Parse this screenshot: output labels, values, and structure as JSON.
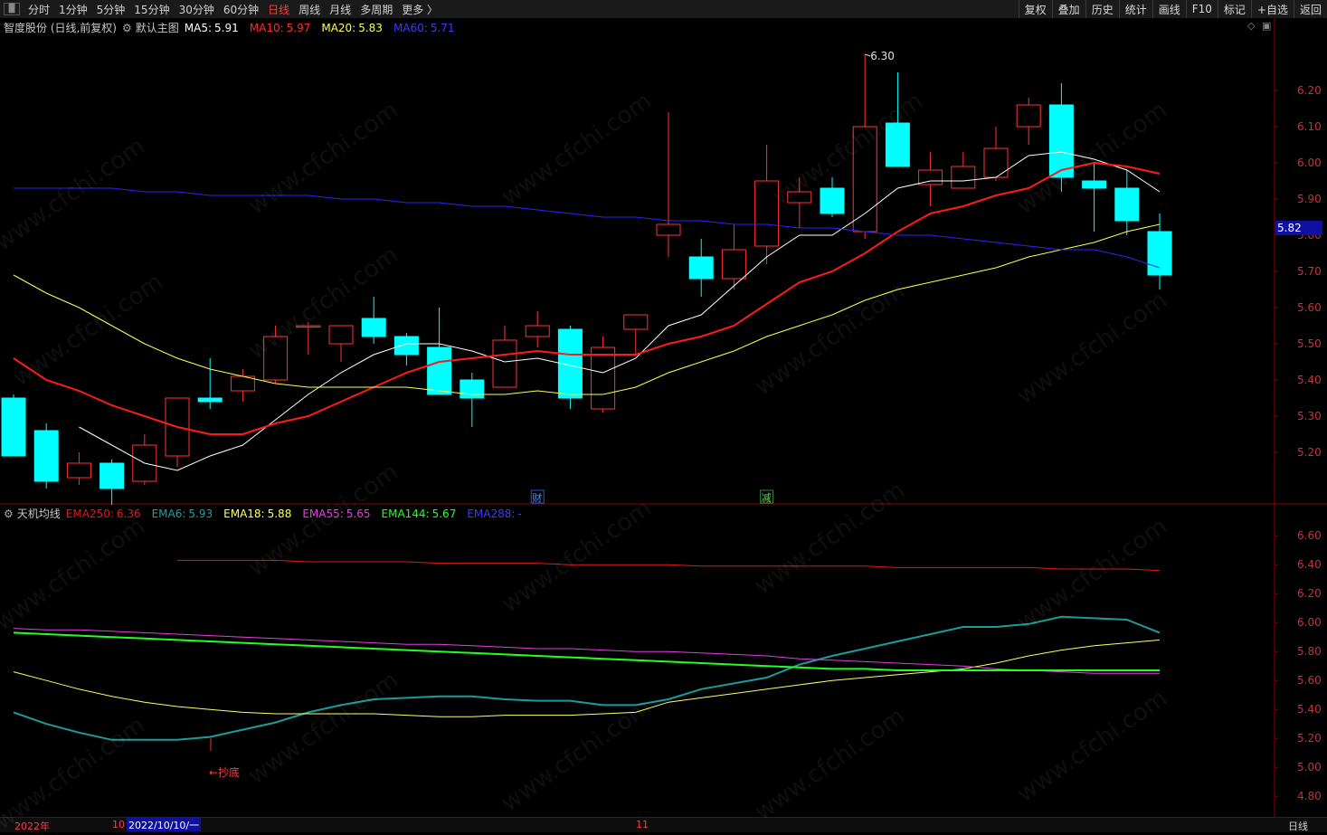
{
  "toolbar": {
    "periods": [
      "分时",
      "1分钟",
      "5分钟",
      "15分钟",
      "30分钟",
      "60分钟",
      "日线",
      "周线",
      "月线",
      "多周期",
      "更多 〉"
    ],
    "active_period": "日线",
    "tools": [
      "复权",
      "叠加",
      "历史",
      "统计",
      "画线",
      "F10",
      "标记",
      "+自选",
      "返回"
    ]
  },
  "main_legend": {
    "stock": "智度股份 (日线,前复权)",
    "indicator": "默认主图",
    "ma5_label": "MA5:",
    "ma5_value": "5.91",
    "ma10_label": "MA10:",
    "ma10_value": "5.97",
    "ma20_label": "MA20:",
    "ma20_value": "5.83",
    "ma60_label": "MA60:",
    "ma60_value": "5.71"
  },
  "sub_legend": {
    "name": "天机均线",
    "ema250_label": "EMA250:",
    "ema250_value": "6.36",
    "ema6_label": "EMA6:",
    "ema6_value": "5.93",
    "ema18_label": "EMA18:",
    "ema18_value": "5.88",
    "ema55_label": "EMA55:",
    "ema55_value": "5.65",
    "ema144_label": "EMA144:",
    "ema144_value": "5.67",
    "ema288_label": "EMA288:",
    "ema288_value": "-"
  },
  "annotations": {
    "high_marker": "6.30",
    "low_marker": "5.05",
    "price_tag": "5.82",
    "cai": "财",
    "jian": "减",
    "chaodi": "←抄底"
  },
  "bottom": {
    "year": "2022年",
    "month10": "10",
    "date": "2022/10/10/一",
    "month11": "11",
    "cycle": "日线"
  },
  "watermark": "www.cfchi.com",
  "colors": {
    "up": "#ff3232",
    "down": "#00ffff",
    "ma5": "#ffffff",
    "ma10": "#ff1a1a",
    "ma20": "#ffff4d",
    "ma60": "#2626ff",
    "ema250": "#e01818",
    "ema6": "#1a9c9c",
    "ema18": "#ffff66",
    "ema55": "#e040e0",
    "ema144": "#22ff22",
    "ema288": "#3030ff"
  },
  "chart_data": [
    {
      "type": "candlestick",
      "y_ticks": [
        "6.20",
        "6.10",
        "6.00",
        "5.90",
        "5.80",
        "5.70",
        "5.60",
        "5.50",
        "5.40",
        "5.30",
        "5.20"
      ],
      "ylim": [
        5.1,
        6.35
      ],
      "candles": [
        {
          "o": 5.35,
          "h": 5.36,
          "l": 5.19,
          "c": 5.19
        },
        {
          "o": 5.26,
          "h": 5.28,
          "l": 5.1,
          "c": 5.12
        },
        {
          "o": 5.13,
          "h": 5.2,
          "l": 5.11,
          "c": 5.17
        },
        {
          "o": 5.17,
          "h": 5.18,
          "l": 5.05,
          "c": 5.1
        },
        {
          "o": 5.12,
          "h": 5.25,
          "l": 5.11,
          "c": 5.22
        },
        {
          "o": 5.19,
          "h": 5.35,
          "l": 5.16,
          "c": 5.35
        },
        {
          "o": 5.35,
          "h": 5.46,
          "l": 5.32,
          "c": 5.34
        },
        {
          "o": 5.37,
          "h": 5.43,
          "l": 5.34,
          "c": 5.41
        },
        {
          "o": 5.4,
          "h": 5.55,
          "l": 5.39,
          "c": 5.52
        },
        {
          "o": 5.55,
          "h": 5.56,
          "l": 5.47,
          "c": 5.55
        },
        {
          "o": 5.5,
          "h": 5.55,
          "l": 5.45,
          "c": 5.55
        },
        {
          "o": 5.57,
          "h": 5.63,
          "l": 5.5,
          "c": 5.52
        },
        {
          "o": 5.52,
          "h": 5.53,
          "l": 5.44,
          "c": 5.47
        },
        {
          "o": 5.49,
          "h": 5.6,
          "l": 5.36,
          "c": 5.36
        },
        {
          "o": 5.4,
          "h": 5.42,
          "l": 5.27,
          "c": 5.35
        },
        {
          "o": 5.38,
          "h": 5.55,
          "l": 5.38,
          "c": 5.51
        },
        {
          "o": 5.52,
          "h": 5.59,
          "l": 5.49,
          "c": 5.55
        },
        {
          "o": 5.54,
          "h": 5.55,
          "l": 5.32,
          "c": 5.35
        },
        {
          "o": 5.32,
          "h": 5.52,
          "l": 5.31,
          "c": 5.49
        },
        {
          "o": 5.54,
          "h": 5.58,
          "l": 5.47,
          "c": 5.58
        },
        {
          "o": 5.8,
          "h": 6.14,
          "l": 5.74,
          "c": 5.83
        },
        {
          "o": 5.74,
          "h": 5.79,
          "l": 5.63,
          "c": 5.68
        },
        {
          "o": 5.68,
          "h": 5.83,
          "l": 5.65,
          "c": 5.76
        },
        {
          "o": 5.77,
          "h": 6.05,
          "l": 5.72,
          "c": 5.95
        },
        {
          "o": 5.89,
          "h": 5.96,
          "l": 5.82,
          "c": 5.92
        },
        {
          "o": 5.93,
          "h": 5.96,
          "l": 5.85,
          "c": 5.86
        },
        {
          "o": 5.81,
          "h": 6.3,
          "l": 5.79,
          "c": 6.1
        },
        {
          "o": 6.11,
          "h": 6.25,
          "l": 5.99,
          "c": 5.99
        },
        {
          "o": 5.94,
          "h": 6.03,
          "l": 5.88,
          "c": 5.98
        },
        {
          "o": 5.93,
          "h": 6.03,
          "l": 5.93,
          "c": 5.99
        },
        {
          "o": 5.96,
          "h": 6.1,
          "l": 5.95,
          "c": 6.04
        },
        {
          "o": 6.1,
          "h": 6.18,
          "l": 6.05,
          "c": 6.16
        },
        {
          "o": 6.16,
          "h": 6.22,
          "l": 5.92,
          "c": 5.96
        },
        {
          "o": 5.95,
          "h": 6.0,
          "l": 5.81,
          "c": 5.93
        },
        {
          "o": 5.93,
          "h": 5.98,
          "l": 5.8,
          "c": 5.84
        },
        {
          "o": 5.81,
          "h": 5.86,
          "l": 5.65,
          "c": 5.69
        }
      ],
      "series": [
        {
          "name": "MA5",
          "values": [
            null,
            null,
            5.27,
            5.22,
            5.17,
            5.15,
            5.19,
            5.22,
            5.29,
            5.36,
            5.42,
            5.47,
            5.5,
            5.5,
            5.48,
            5.45,
            5.46,
            5.44,
            5.42,
            5.46,
            5.55,
            5.58,
            5.66,
            5.74,
            5.8,
            5.8,
            5.86,
            5.93,
            5.95,
            5.95,
            5.96,
            6.02,
            6.03,
            6.01,
            5.98,
            5.92
          ]
        },
        {
          "name": "MA10",
          "values": [
            5.46,
            5.4,
            5.37,
            5.33,
            5.3,
            5.27,
            5.25,
            5.25,
            5.28,
            5.3,
            5.34,
            5.38,
            5.42,
            5.45,
            5.46,
            5.47,
            5.48,
            5.47,
            5.47,
            5.47,
            5.5,
            5.52,
            5.55,
            5.61,
            5.67,
            5.7,
            5.75,
            5.81,
            5.86,
            5.88,
            5.91,
            5.93,
            5.98,
            6.0,
            5.99,
            5.97
          ]
        },
        {
          "name": "MA20",
          "values": [
            5.69,
            5.64,
            5.6,
            5.55,
            5.5,
            5.46,
            5.43,
            5.41,
            5.39,
            5.38,
            5.38,
            5.38,
            5.38,
            5.37,
            5.36,
            5.36,
            5.37,
            5.36,
            5.36,
            5.38,
            5.42,
            5.45,
            5.48,
            5.52,
            5.55,
            5.58,
            5.62,
            5.65,
            5.67,
            5.69,
            5.71,
            5.74,
            5.76,
            5.78,
            5.81,
            5.83
          ]
        },
        {
          "name": "MA60",
          "values": [
            5.93,
            5.93,
            5.93,
            5.93,
            5.92,
            5.92,
            5.91,
            5.91,
            5.91,
            5.91,
            5.9,
            5.9,
            5.89,
            5.89,
            5.88,
            5.88,
            5.87,
            5.86,
            5.85,
            5.85,
            5.84,
            5.84,
            5.83,
            5.83,
            5.82,
            5.82,
            5.81,
            5.8,
            5.8,
            5.79,
            5.78,
            5.77,
            5.76,
            5.76,
            5.74,
            5.71
          ]
        }
      ]
    },
    {
      "type": "line",
      "y_ticks": [
        "6.60",
        "6.40",
        "6.20",
        "6.00",
        "5.80",
        "5.60",
        "5.40",
        "5.20",
        "5.00",
        "4.80"
      ],
      "ylim": [
        4.72,
        6.72
      ],
      "series": [
        {
          "name": "EMA250",
          "values": [
            null,
            null,
            null,
            null,
            null,
            6.43,
            6.43,
            6.43,
            6.43,
            6.42,
            6.42,
            6.42,
            6.42,
            6.41,
            6.41,
            6.41,
            6.41,
            6.4,
            6.4,
            6.4,
            6.4,
            6.39,
            6.39,
            6.39,
            6.39,
            6.39,
            6.39,
            6.38,
            6.38,
            6.38,
            6.38,
            6.38,
            6.37,
            6.37,
            6.37,
            6.36
          ]
        },
        {
          "name": "EMA6",
          "values": [
            5.38,
            5.3,
            5.24,
            5.19,
            5.19,
            5.19,
            5.21,
            5.26,
            5.31,
            5.38,
            5.43,
            5.47,
            5.48,
            5.49,
            5.49,
            5.47,
            5.46,
            5.46,
            5.43,
            5.43,
            5.47,
            5.54,
            5.58,
            5.62,
            5.71,
            5.77,
            5.82,
            5.87,
            5.92,
            5.97,
            5.97,
            5.99,
            6.04,
            6.03,
            6.02,
            5.93
          ]
        },
        {
          "name": "EMA18",
          "values": [
            5.66,
            5.6,
            5.54,
            5.49,
            5.45,
            5.42,
            5.4,
            5.38,
            5.37,
            5.37,
            5.37,
            5.37,
            5.36,
            5.35,
            5.35,
            5.36,
            5.36,
            5.36,
            5.37,
            5.38,
            5.45,
            5.48,
            5.51,
            5.54,
            5.57,
            5.6,
            5.62,
            5.64,
            5.66,
            5.68,
            5.72,
            5.77,
            5.81,
            5.84,
            5.86,
            5.88
          ]
        },
        {
          "name": "EMA55",
          "values": [
            5.96,
            5.95,
            5.95,
            5.94,
            5.93,
            5.92,
            5.91,
            5.9,
            5.89,
            5.88,
            5.87,
            5.86,
            5.85,
            5.85,
            5.84,
            5.83,
            5.82,
            5.82,
            5.81,
            5.8,
            5.8,
            5.79,
            5.78,
            5.77,
            5.75,
            5.74,
            5.73,
            5.72,
            5.71,
            5.7,
            5.68,
            5.67,
            5.66,
            5.65,
            5.65,
            5.65
          ]
        },
        {
          "name": "EMA144",
          "values": [
            5.93,
            5.92,
            5.91,
            5.9,
            5.89,
            5.88,
            5.87,
            5.86,
            5.85,
            5.84,
            5.83,
            5.82,
            5.81,
            5.8,
            5.79,
            5.78,
            5.77,
            5.76,
            5.75,
            5.74,
            5.73,
            5.72,
            5.71,
            5.7,
            5.69,
            5.68,
            5.68,
            5.67,
            5.67,
            5.67,
            5.67,
            5.67,
            5.67,
            5.67,
            5.67,
            5.67
          ]
        }
      ]
    }
  ]
}
